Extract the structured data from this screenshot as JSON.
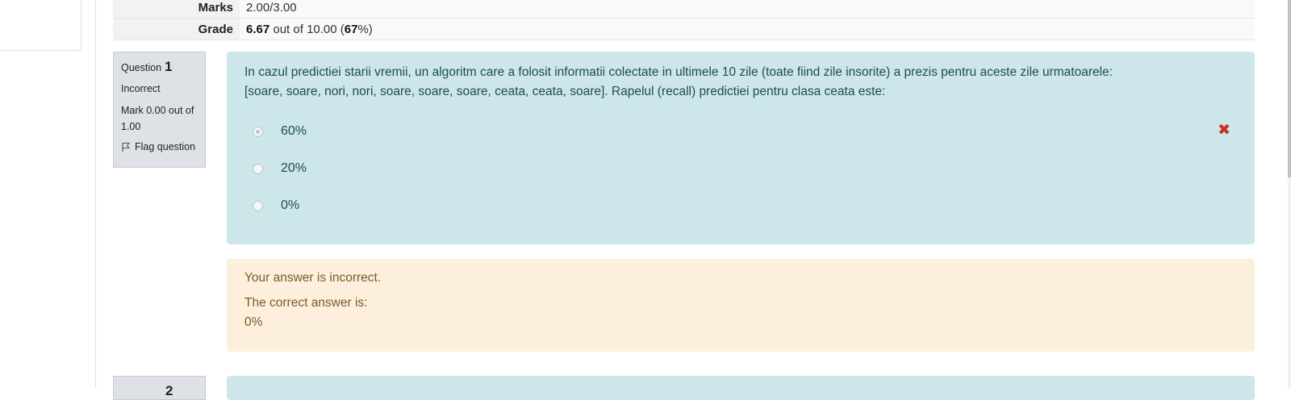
{
  "summary": {
    "marks_label": "Marks",
    "marks_value": "2.00/3.00",
    "grade_label": "Grade",
    "grade_score": "6.67",
    "grade_middle": " out of 10.00 (",
    "grade_percent": "67",
    "grade_end": "%)"
  },
  "question1": {
    "prefix": "Question",
    "number": "1",
    "state": "Incorrect",
    "grade": "Mark 0.00 out of 1.00",
    "flag_label": "Flag question",
    "text_line1": "In cazul predictiei starii vremii, un algoritm care a folosit informatii colectate in ultimele 10 zile (toate fiind zile insorite) a prezis pentru aceste zile urmatoarele:",
    "text_line2": "[soare, soare, nori, nori, soare, soare, soare, ceata, ceata, soare]. Rapelul (recall) predictiei pentru clasa ceata este:",
    "options": [
      "60%",
      "20%",
      "0%"
    ],
    "selected_index": 0,
    "incorrect_icon": "cross-icon",
    "feedback_status": "Your answer is incorrect.",
    "feedback_correct_label": "The correct answer is:",
    "feedback_correct_value": "0%"
  },
  "question2": {
    "number": "2"
  },
  "colors": {
    "question_bg": "#cce6ea",
    "feedback_bg": "#fcefdc",
    "info_bg": "#dee2e6",
    "incorrect": "#ca3120"
  }
}
